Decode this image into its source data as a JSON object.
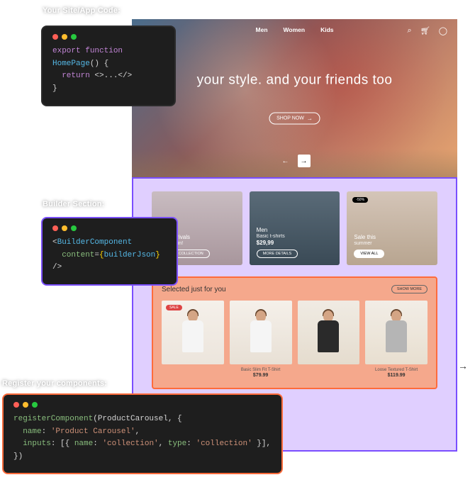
{
  "labels": {
    "site_code": "Your Site/App Code:",
    "builder_section": "Builder Section:",
    "register_components": "Register your components:"
  },
  "code1": {
    "l1a": "export ",
    "l1b": "function ",
    "l1c": "HomePage",
    "l1d": "() {",
    "l2a": "return ",
    "l2b": "<>...</>",
    "l3": "}"
  },
  "code2": {
    "l1a": "<",
    "l1b": "BuilderComponent",
    "l2a": "content",
    "l2b": "=",
    "l2c": "{",
    "l2d": "builderJson",
    "l2e": "}",
    "l2f": " />"
  },
  "code3": {
    "l1a": "registerComponent",
    "l1b": "(ProductCarousel, {",
    "l2a": "name",
    "l2b": ": ",
    "l2c": "'Product Carousel'",
    "l2d": ",",
    "l3a": "inputs",
    "l3b": ": [{ ",
    "l3c": "name",
    "l3d": ": ",
    "l3e": "'collection'",
    "l3f": ", ",
    "l3g": "type",
    "l3h": ": ",
    "l3i": "'collection'",
    "l3j": " }],",
    "l4": "})"
  },
  "nav": {
    "items": [
      "Men",
      "Women",
      "Kids"
    ]
  },
  "hero": {
    "headline": "your style. and your friends too",
    "cta": "SHOP NOW",
    "arrow": "→",
    "prev": "←",
    "next": "→"
  },
  "cards": [
    {
      "title": "New arrivals",
      "sub": "are now in!",
      "btn": "SHOW COLLECTION"
    },
    {
      "title": "Men",
      "sub": "Basic t-shirts",
      "price": "$29,99",
      "btn": "MORE DETAILS"
    },
    {
      "badge": "-50%",
      "title": "Sale this",
      "sub": "summer",
      "btn": "VIEW ALL"
    }
  ],
  "selected": {
    "title": "Selected just for you",
    "show_more": "SHOW MORE",
    "products": [
      {
        "badge": "SALE",
        "name": "",
        "price": ""
      },
      {
        "name": "Basic Slim Fit T-Shirt",
        "price": "$79.99"
      },
      {
        "name": "",
        "price": ""
      },
      {
        "name": "Loose Textured T-Shirt",
        "price": "$119.99"
      }
    ]
  },
  "side_arrow": "→"
}
